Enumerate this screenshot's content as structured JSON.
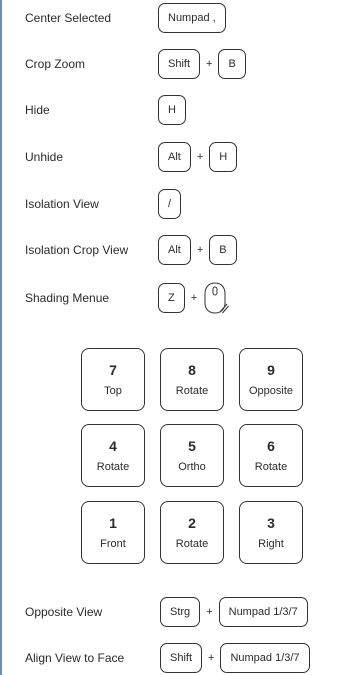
{
  "shortcuts": [
    {
      "label": "Center Selected",
      "keys": [
        "Numpad ,"
      ]
    },
    {
      "label": "Crop Zoom",
      "keys": [
        "Shift",
        "B"
      ]
    },
    {
      "label": "Hide",
      "keys": [
        "H"
      ]
    },
    {
      "label": "Unhide",
      "keys": [
        "Alt",
        "H"
      ]
    },
    {
      "label": "Isolation View",
      "keys": [
        "/"
      ]
    },
    {
      "label": "Isolation Crop View",
      "keys": [
        "Alt",
        "B"
      ]
    },
    {
      "label": "Shading Menue",
      "keys": [
        "Z"
      ],
      "mouse_icon": "mouse-middle-button-icon"
    }
  ],
  "plus": "+",
  "numpad": [
    {
      "num": "7",
      "label": "Top"
    },
    {
      "num": "8",
      "label": "Rotate"
    },
    {
      "num": "9",
      "label": "Opposite"
    },
    {
      "num": "4",
      "label": "Rotate"
    },
    {
      "num": "5",
      "label": "Ortho"
    },
    {
      "num": "6",
      "label": "Rotate"
    },
    {
      "num": "1",
      "label": "Front"
    },
    {
      "num": "2",
      "label": "Rotate"
    },
    {
      "num": "3",
      "label": "Right"
    }
  ],
  "bottom_shortcuts": [
    {
      "label": "Opposite View",
      "keys": [
        "Strg",
        "Numpad 1/3/7"
      ]
    },
    {
      "label": "Align View to Face",
      "keys": [
        "Shift",
        "Numpad 1/3/7"
      ]
    }
  ]
}
